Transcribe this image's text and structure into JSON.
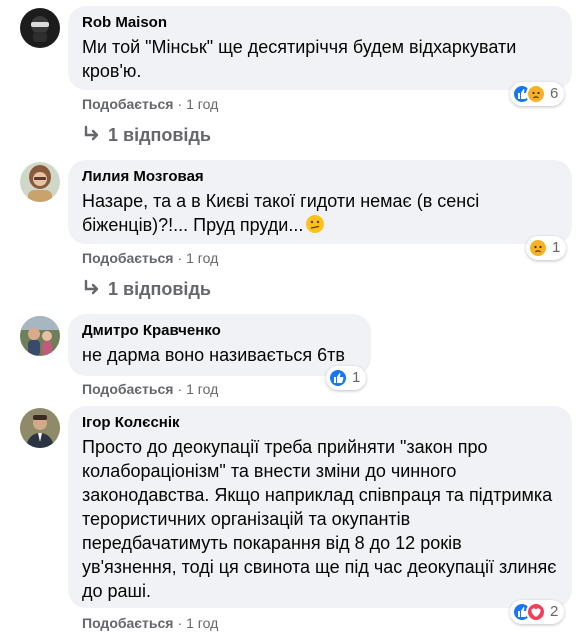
{
  "comments": [
    {
      "author": "Rob Maison",
      "text": "Ми той \"Мінськ\" ще десятиріччя будем відхаркувати кров'ю.",
      "like_label": "Подобається",
      "time": "1 год",
      "reaction_count": "6",
      "reaction_icons": [
        "like-icon",
        "sad-icon"
      ],
      "replies": "1 відповідь"
    },
    {
      "author": "Лилия Мозговая",
      "text": "Назаре, та а в Києві такої гидоти немає (в сенсі біженців)?!... Пруд пруди...",
      "inline_emoji": "confused-emoji-icon",
      "like_label": "Подобається",
      "time": "1 год",
      "reaction_count": "1",
      "reaction_icons": [
        "sad-icon"
      ],
      "replies": "1 відповідь"
    },
    {
      "author": "Дмитро Кравченко",
      "text": "не дарма воно називається 6тв",
      "like_label": "Подобається",
      "time": "1 год",
      "reaction_count": "1",
      "reaction_icons": [
        "like-icon"
      ]
    },
    {
      "author": "Ігор Колєснік",
      "text": "Просто до деокупації треба прийняти \"закон про колабораціонізм\" та внести зміни до чинного законодавства. Якщо наприклад співпраця та підтримка терористичних організацій та окупантів передбачатимуть покарання від 8 до 12 років ув'язнення, тоді ця свинота ще під час деокупації злиняє до раші.",
      "like_label": "Подобається",
      "time": "1 год",
      "reaction_count": "2",
      "reaction_icons": [
        "like-icon",
        "love-icon"
      ]
    }
  ],
  "separator": "·",
  "colors": {
    "bubble": "#f0f2f5",
    "meta_text": "#65676b",
    "like_blue": "#1877f2",
    "love_red": "#f33e58",
    "sad_yellow": "#f7b125"
  }
}
